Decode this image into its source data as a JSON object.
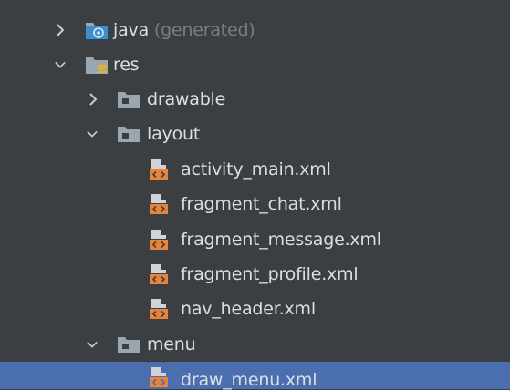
{
  "project_tree": {
    "nodes": [
      {
        "label": "java",
        "hint": "(generated)",
        "expanded": false,
        "icon": "java-generated-folder-icon"
      },
      {
        "label": "res",
        "expanded": true,
        "icon": "resources-folder-icon"
      },
      {
        "label": "drawable",
        "expanded": false,
        "icon": "folder-icon"
      },
      {
        "label": "layout",
        "expanded": true,
        "icon": "folder-icon"
      },
      {
        "label": "activity_main.xml",
        "icon": "layout-xml-file-icon"
      },
      {
        "label": "fragment_chat.xml",
        "icon": "layout-xml-file-icon"
      },
      {
        "label": "fragment_message.xml",
        "icon": "layout-xml-file-icon"
      },
      {
        "label": "fragment_profile.xml",
        "icon": "layout-xml-file-icon"
      },
      {
        "label": "nav_header.xml",
        "icon": "layout-xml-file-icon"
      },
      {
        "label": "menu",
        "expanded": true,
        "icon": "folder-icon"
      },
      {
        "label": "draw_menu.xml",
        "icon": "layout-xml-file-icon",
        "selected": true
      }
    ]
  },
  "colors": {
    "background": "#3c3f41",
    "selection": "#4b6eaf",
    "text": "#dbdfe3",
    "hint_text": "#7a7e82",
    "xml_icon_orange": "#e8833a",
    "folder_gray": "#9aa7b0",
    "java_folder_blue": "#3a8fd1"
  }
}
